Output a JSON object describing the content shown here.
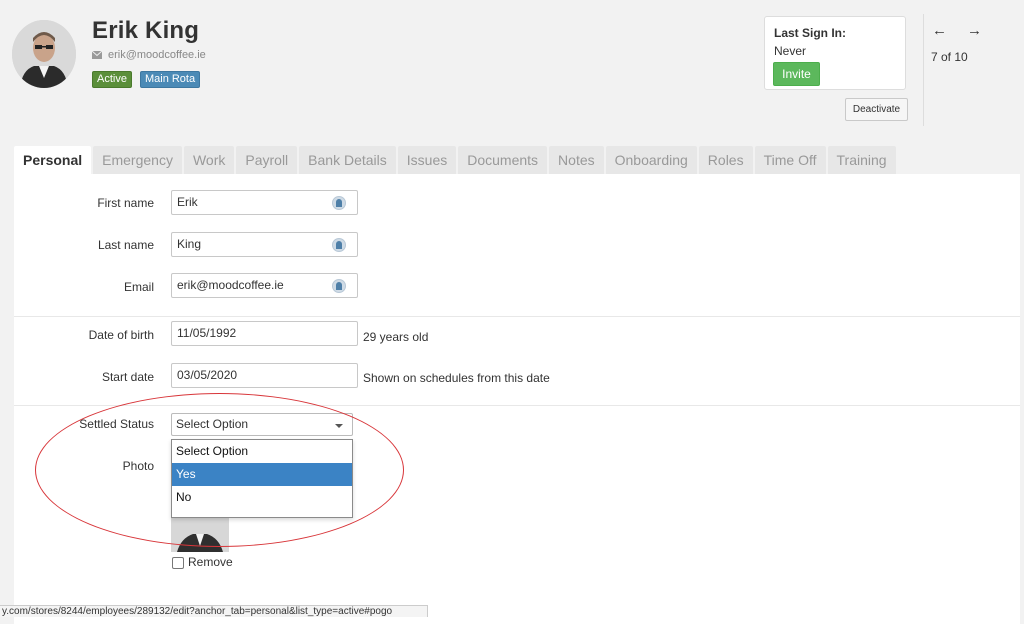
{
  "profile": {
    "name": "Erik King",
    "email": "erik@moodcoffee.ie",
    "badges": [
      "Active",
      "Main Rota"
    ]
  },
  "signin": {
    "title": "Last Sign In:",
    "value": "Never",
    "invite_label": "Invite"
  },
  "actions": {
    "deactivate_label": "Deactivate"
  },
  "pager": {
    "text": "7 of 10",
    "prev": "←",
    "next": "→"
  },
  "tabs": [
    "Personal",
    "Emergency",
    "Work",
    "Payroll",
    "Bank Details",
    "Issues",
    "Documents",
    "Notes",
    "Onboarding",
    "Roles",
    "Time Off",
    "Training"
  ],
  "active_tab": "Personal",
  "form": {
    "first_name_label": "First name",
    "first_name_value": "Erik",
    "last_name_label": "Last name",
    "last_name_value": "King",
    "email_label": "Email",
    "email_value": "erik@moodcoffee.ie",
    "dob_label": "Date of birth",
    "dob_value": "11/05/1992",
    "dob_hint": "29 years old",
    "start_label": "Start date",
    "start_value": "03/05/2020",
    "start_hint": "Shown on schedules from this date",
    "settled_label": "Settled Status",
    "settled_value": "Select Option",
    "settled_options": [
      "Select Option",
      "Yes",
      "No"
    ],
    "settled_highlighted": "Yes",
    "photo_label": "Photo",
    "remove_label": "Remove"
  },
  "status_bar": {
    "url": "y.com/stores/8244/employees/289132/edit?anchor_tab=personal&list_type=active#pogo"
  },
  "colors": {
    "annotation_ellipse": "#d8363a",
    "highlight": "#3b83c5",
    "invite": "#5cb85c",
    "active_badge": "#5b8f3a",
    "rota_badge": "#4b8ab6"
  }
}
